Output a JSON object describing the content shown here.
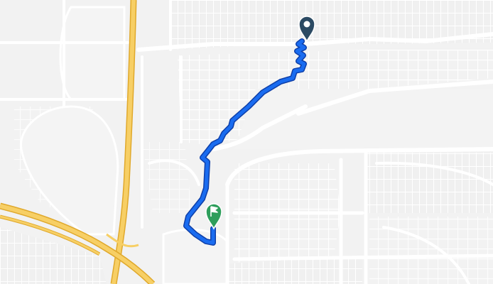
{
  "map": {
    "colors": {
      "background": "#f2f2f2",
      "street": "#ffffff",
      "highway": "#f2c14e",
      "highway_edge": "#e0a92c",
      "route": "#1a5fdc",
      "route_edge": "#0e3fa8",
      "start_pin": "#2b4a63",
      "end_pin": "#2e9e5b"
    },
    "route_label": "route",
    "markers": {
      "start": {
        "icon": "location-pin-icon"
      },
      "end": {
        "icon": "flag-pin-icon"
      }
    }
  }
}
